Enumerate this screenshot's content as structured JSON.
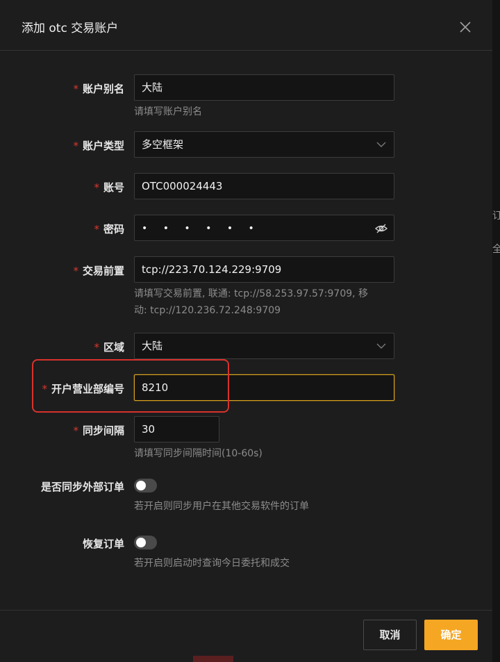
{
  "dialog": {
    "title": "添加 otc 交易账户",
    "close_icon": "close-icon"
  },
  "form": {
    "alias": {
      "label": "账户别名",
      "value": "大陆",
      "help": "请填写账户别名"
    },
    "type": {
      "label": "账户类型",
      "value": "多空框架"
    },
    "account": {
      "label": "账号",
      "value": "OTC000024443"
    },
    "password": {
      "label": "密码",
      "value": "• • • • • •"
    },
    "front": {
      "label": "交易前置",
      "value": "tcp://223.70.124.229:9709",
      "help_line1": "请填写交易前置, 联通: tcp://58.253.97.57:9709, 移",
      "help_line2": "动: tcp://120.236.72.248:9709"
    },
    "region": {
      "label": "区域",
      "value": "大陆"
    },
    "branch": {
      "label": "开户营业部编号",
      "value": "8210"
    },
    "interval": {
      "label": "同步间隔",
      "value": "30",
      "help": "请填写同步间隔时间(10-60s)"
    },
    "sync_external": {
      "label": "是否同步外部订单",
      "help": "若开启则同步用户在其他交易软件的订单",
      "on": false
    },
    "restore_orders": {
      "label": "恢复订单",
      "help": "若开启则启动时查询今日委托和成交",
      "on": false
    }
  },
  "required_mark": "*",
  "footer": {
    "cancel": "取消",
    "ok": "确定"
  },
  "background_fragments": [
    "订",
    "全"
  ],
  "colors": {
    "accent": "#f5a623",
    "required": "#d9372d",
    "highlight": "#d9322b",
    "focus": "#d9a21b"
  }
}
